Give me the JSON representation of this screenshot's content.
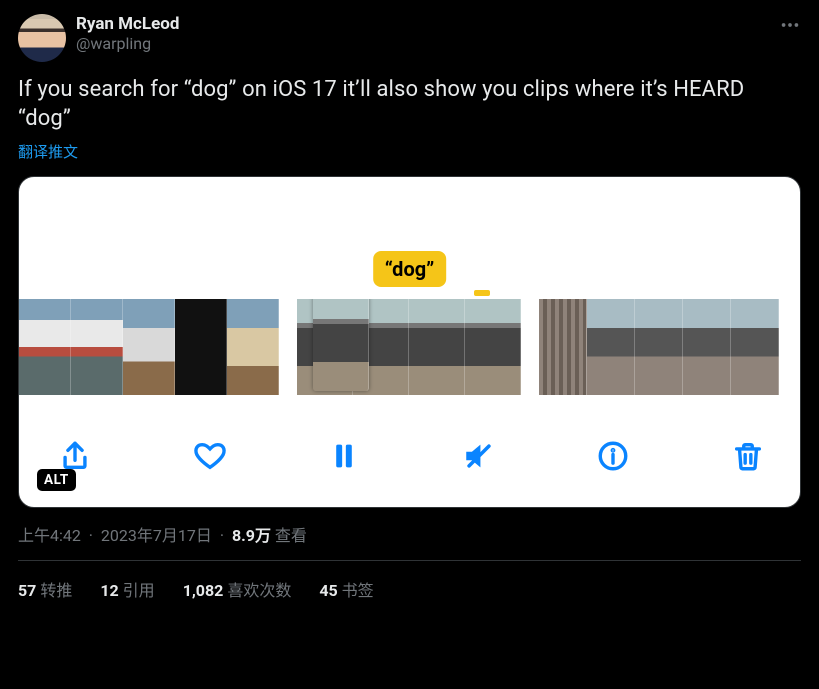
{
  "user": {
    "display_name": "Ryan McLeod",
    "handle": "@warpling"
  },
  "text": "If you search for “dog” on iOS 17 it’ll also show you clips where it’s HEARD “dog”",
  "translate": "翻译推文",
  "media": {
    "label": "“dog”",
    "alt_badge": "ALT"
  },
  "meta": {
    "time": "上午4:42",
    "date": "2023年7月17日",
    "views_count": "8.9万",
    "views_label": "查看"
  },
  "stats": {
    "retweets": {
      "count": "57",
      "label": "转推"
    },
    "quotes": {
      "count": "12",
      "label": "引用"
    },
    "likes": {
      "count": "1,082",
      "label": "喜欢次数"
    },
    "bookmarks": {
      "count": "45",
      "label": "书签"
    }
  }
}
